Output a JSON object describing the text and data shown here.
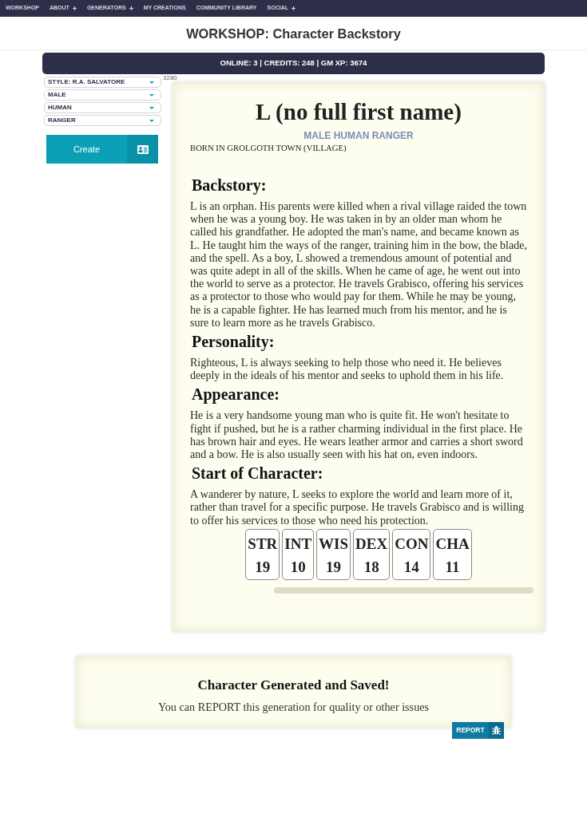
{
  "nav": {
    "items": [
      {
        "label": "WORKSHOP",
        "submenu": false
      },
      {
        "label": "ABOUT",
        "submenu": true
      },
      {
        "label": "GENERATORS",
        "submenu": true
      },
      {
        "label": "MY CREATIONS",
        "submenu": false
      },
      {
        "label": "COMMUNITY LIBRARY",
        "submenu": false
      },
      {
        "label": "SOCIAL",
        "submenu": true
      }
    ]
  },
  "page_title": "WORKSHOP: Character Backstory",
  "status_bar": "ONLINE: 3 | CREDITS: 248 | GM XP: 3674",
  "options": {
    "dropdowns": [
      {
        "value": "STYLE: R.A. SALVATORE"
      },
      {
        "value": "MALE"
      },
      {
        "value": "HUMAN"
      },
      {
        "value": "RANGER"
      }
    ],
    "create_button": "Create"
  },
  "counter": "3280",
  "character": {
    "name": "L (no full first name)",
    "subtitle": "MALE HUMAN RANGER",
    "birthplace": "BORN IN GROLGOTH TOWN (VILLAGE)",
    "sections": [
      {
        "heading": "Backstory:",
        "text": "L is an orphan. His parents were killed when a rival village raided the town when he was a young boy. He was taken in by an older man whom he called his grandfather. He adopted the man's name, and became known as L. He taught him the ways of the ranger, training him in the bow, the blade, and the spell. As a boy, L showed a tremendous amount of potential and was quite adept in all of the skills. When he came of age, he went out into the world to serve as a protector. He travels Grabisco, offering his services as a protector to those who would pay for them. While he may be young, he is a capable fighter. He has learned much from his mentor, and he is sure to learn more as he travels Grabisco."
      },
      {
        "heading": "Personality:",
        "text": "Righteous, L is always seeking to help those who need it. He believes deeply in the ideals of his mentor and seeks to uphold them in his life."
      },
      {
        "heading": "Appearance:",
        "text": "He is a very handsome young man who is quite fit. He won't hesitate to fight if pushed, but he is a rather charming individual in the first place. He has brown hair and eyes. He wears leather armor and carries a short sword and a bow. He is also usually seen with his hat on, even indoors."
      },
      {
        "heading": "Start of Character:",
        "text": "A wanderer by nature, L seeks to explore the world and learn more of it, rather than travel for a specific purpose. He travels Grabisco and is willing to offer his services to those who need his protection."
      }
    ],
    "stats": [
      {
        "label": "STR",
        "value": "19"
      },
      {
        "label": "INT",
        "value": "10"
      },
      {
        "label": "WIS",
        "value": "19"
      },
      {
        "label": "DEX",
        "value": "18"
      },
      {
        "label": "CON",
        "value": "14"
      },
      {
        "label": "CHA",
        "value": "11"
      }
    ]
  },
  "notice": {
    "title": "Character Generated and Saved!",
    "text": "You can REPORT this generation for quality or other issues",
    "report_button": "REPORT"
  }
}
